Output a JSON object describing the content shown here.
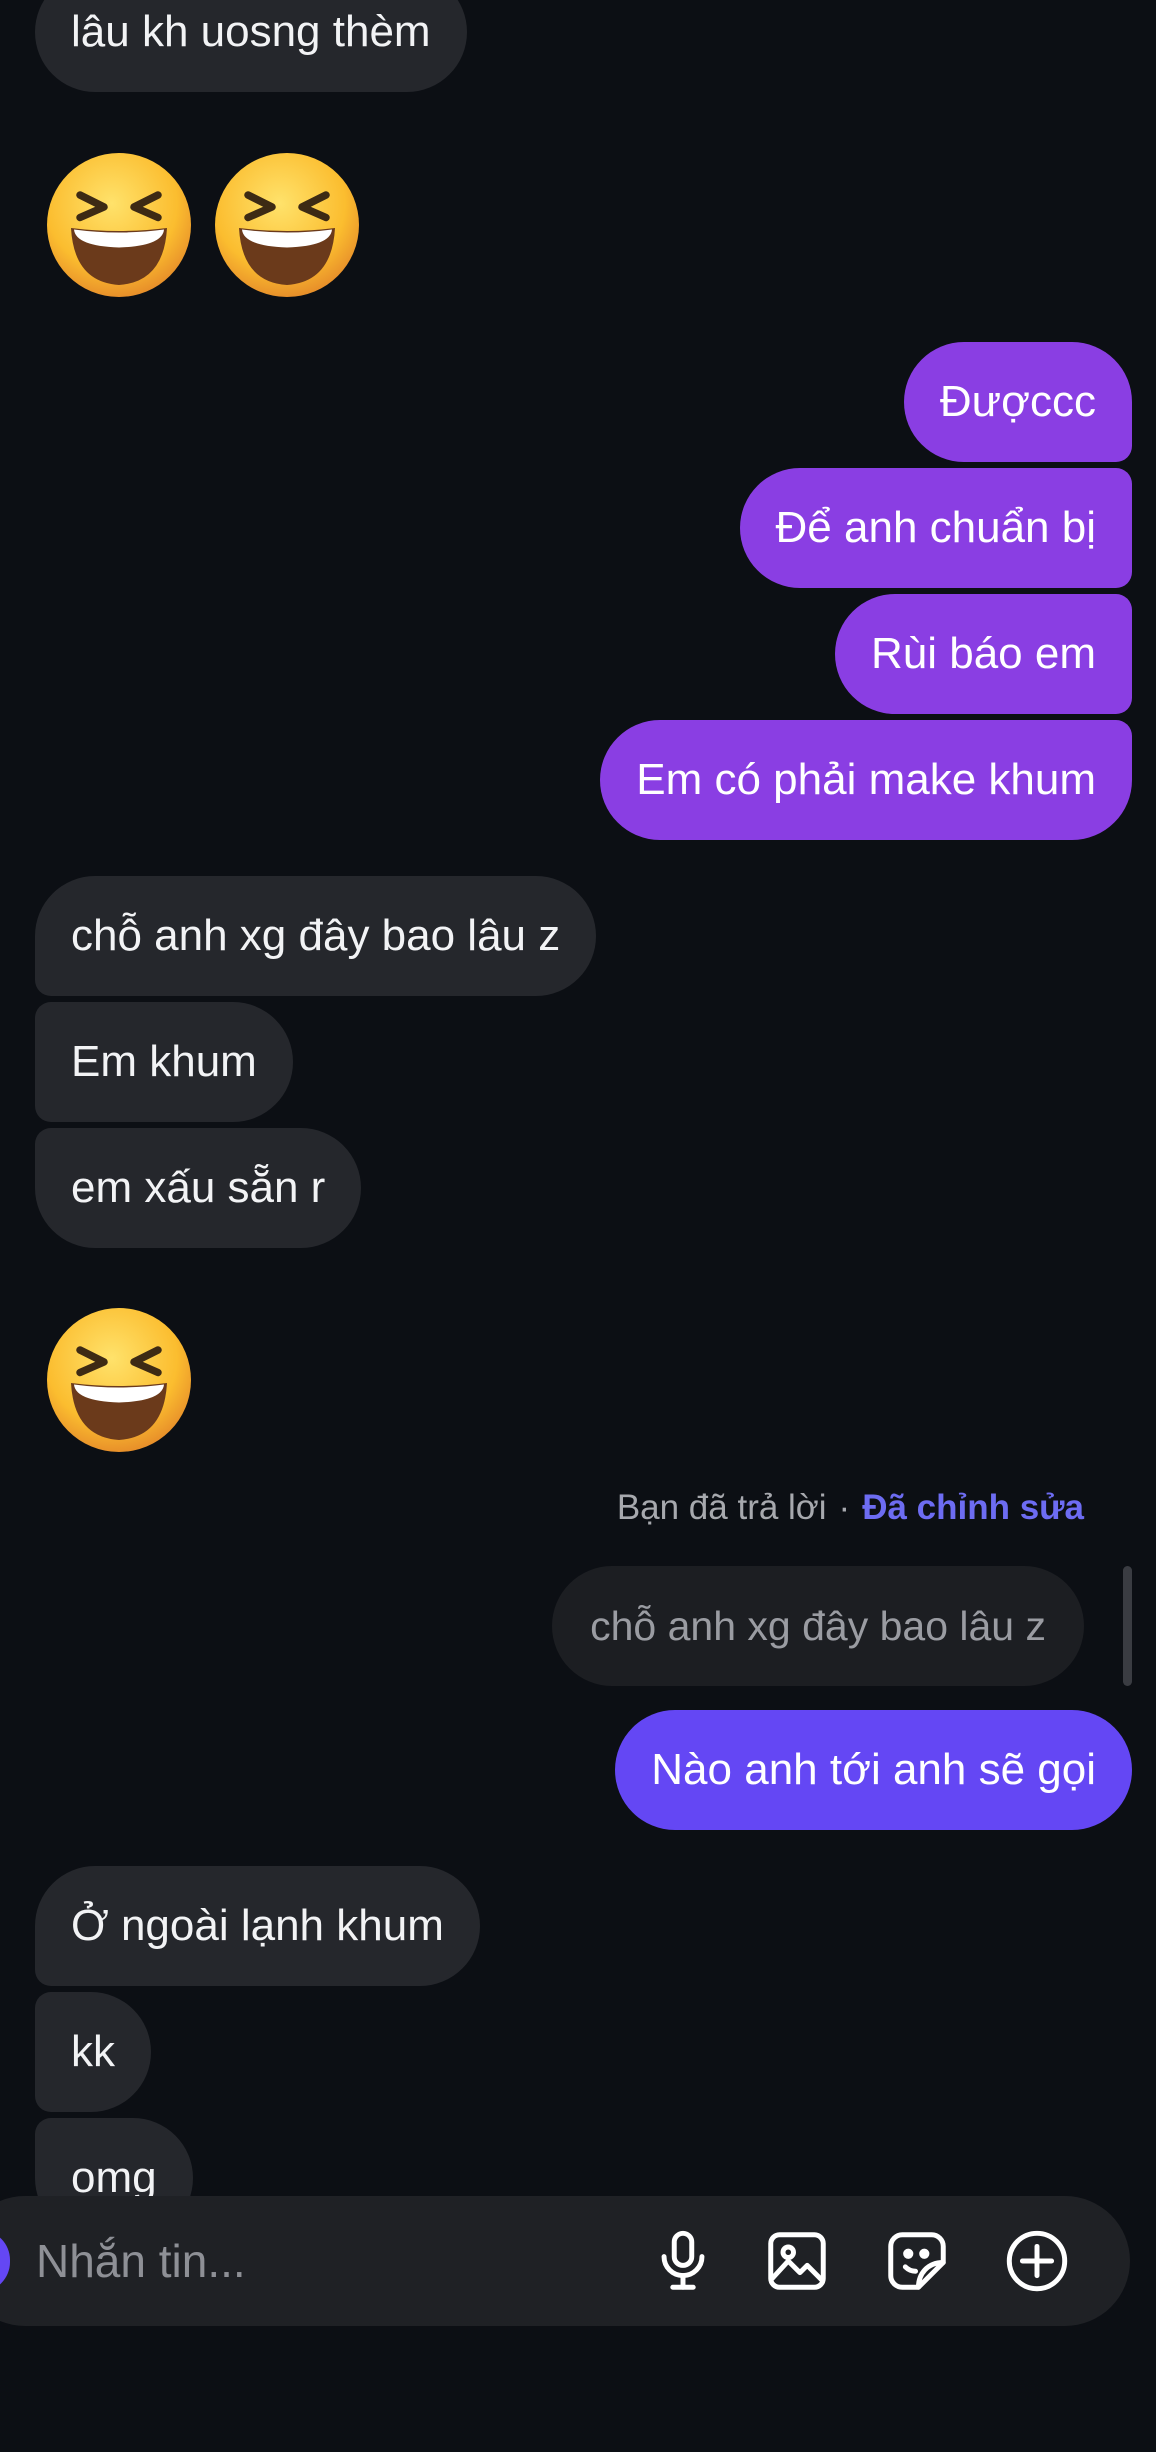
{
  "messages": {
    "m1": "lâu kh uosng thèm",
    "m2": "Đượccc",
    "m3": "Để anh chuẩn bị",
    "m4": "Rùi báo em",
    "m5": "Em có phải make khum",
    "m6": "chỗ anh xg đây bao lâu z",
    "m7": "Em khum",
    "m8": "em xấu sẵn r",
    "m9": "Nào anh tới anh sẽ gọi",
    "m10": "Ở ngoài lạnh khum",
    "m11": "kk",
    "m12": "omg"
  },
  "reply": {
    "label": "Bạn đã trả lời",
    "separator": "·",
    "edited": "Đã chỉnh sửa",
    "quoted": "chỗ anh xg đây bao lâu z"
  },
  "composer": {
    "placeholder": "Nhắn tin..."
  },
  "colors": {
    "background": "#0c0f14",
    "incoming_bubble": "#25272c",
    "outgoing_bubble": "#8a3ee3",
    "outgoing_bubble_latest": "#6447f4",
    "edited_accent": "#6d6cf2"
  },
  "icons": {
    "emoji": "grinning-squinting-face",
    "mic": "microphone-icon",
    "image": "image-icon",
    "sticker": "sticker-icon",
    "plus": "plus-circle-icon"
  }
}
